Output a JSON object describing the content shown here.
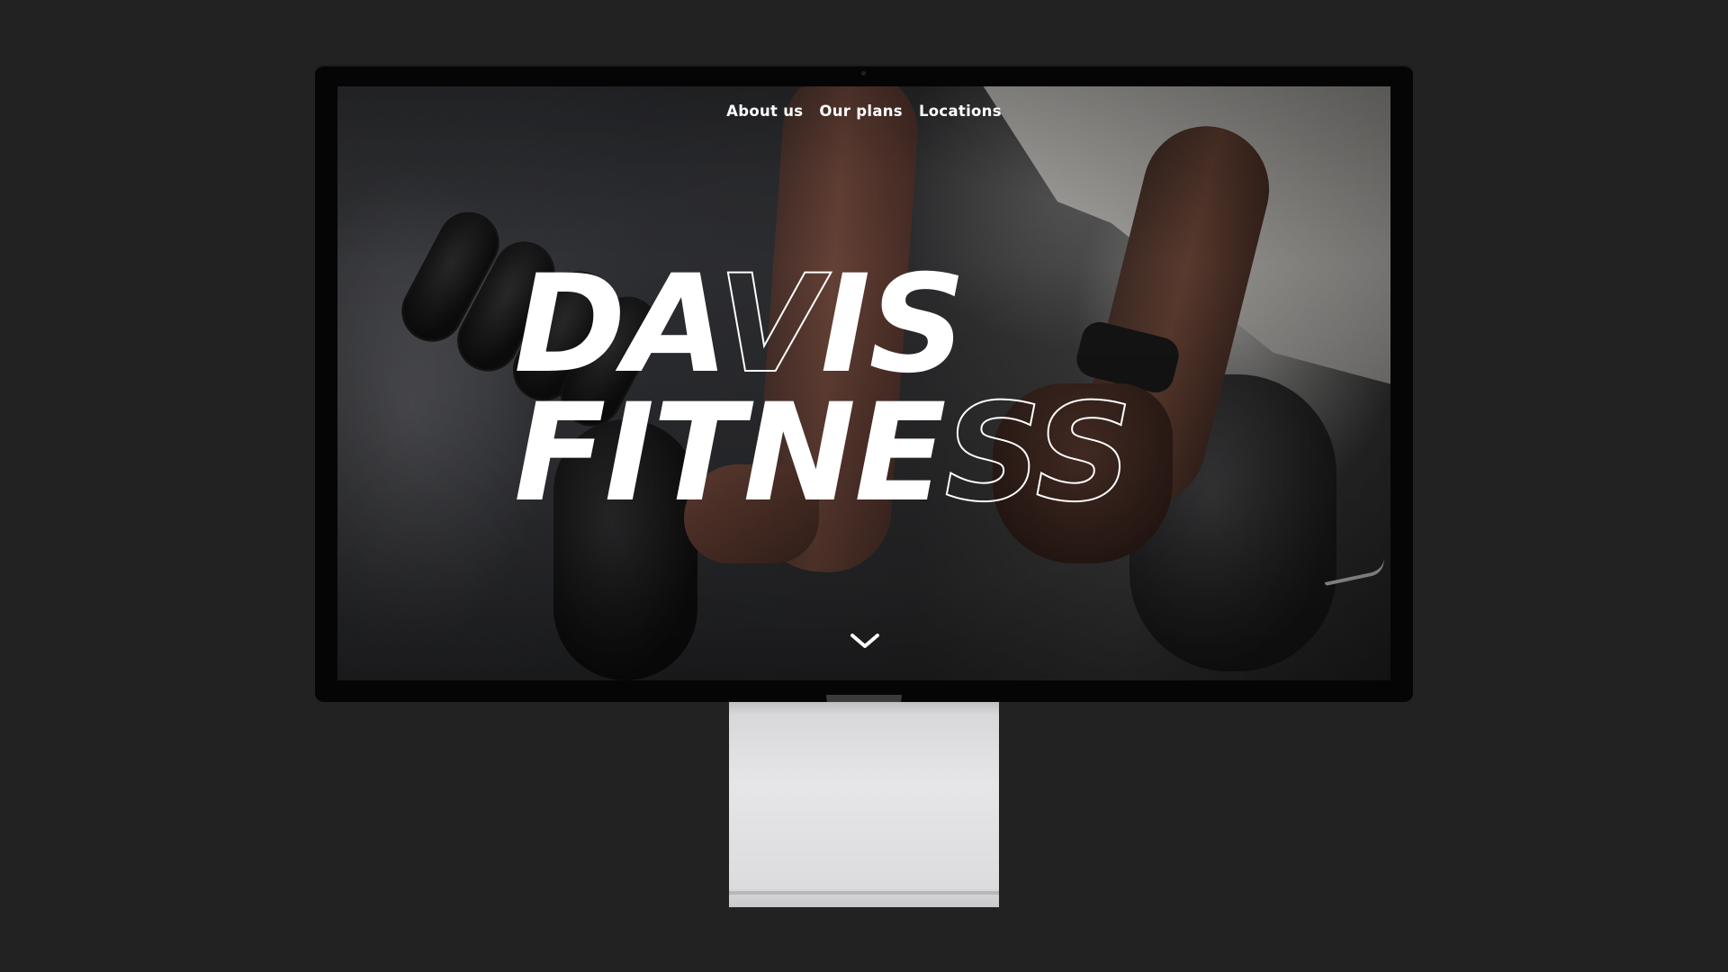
{
  "nav": {
    "items": [
      {
        "label": "About us"
      },
      {
        "label": "Our plans"
      },
      {
        "label": "Locations"
      }
    ]
  },
  "hero": {
    "line1": {
      "solid_a": "DA",
      "outline": "V",
      "solid_b": "IS"
    },
    "line2": {
      "solid": "FITNE",
      "outline": "SS"
    }
  },
  "scroll_icon": "chevron-down-icon",
  "colors": {
    "backdrop": "#222222",
    "bezel": "#050505",
    "text": "#ffffff",
    "stand": "#e6e6e8"
  }
}
